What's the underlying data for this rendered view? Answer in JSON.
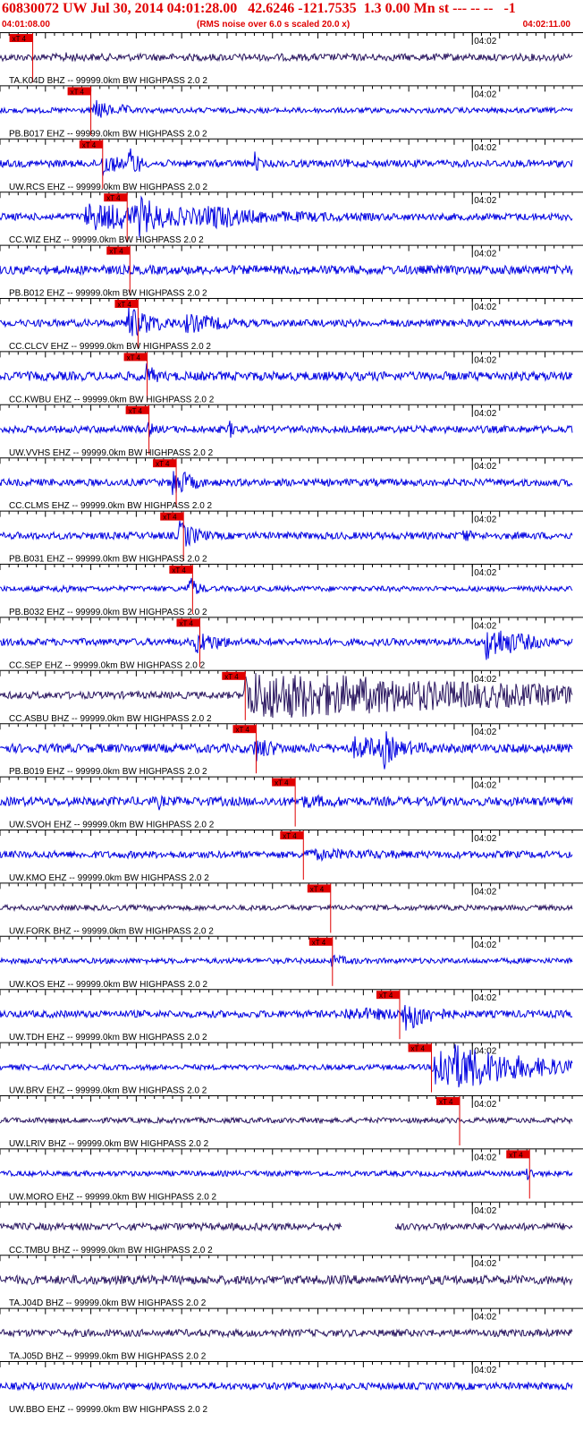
{
  "header": {
    "title": "60830072 UW Jul 30, 2014 04:01:28.00   42.6246 -121.7535  1.3 0.00 Mn st --- -- --   -1",
    "start_time": "04:01:08.00",
    "rms_note": "(RMS noise over 6.0 s scaled 20.0 x)",
    "end_time": "04:02:11.00"
  },
  "colors": {
    "trace": "#0000e0",
    "trace_dark": "#2a1660",
    "pick": "#e00000",
    "text": "#000000",
    "title": "#e00000"
  },
  "chart_data": {
    "type": "line",
    "title": "60830072 UW Jul 30, 2014 04:01:28.00   42.6246 -121.7535  1.3 0.00 Mn st --- -- --   -1",
    "x_range": [
      "04:01:08.00",
      "04:02:11.00"
    ],
    "x_tick_label": "04:02",
    "x_tick_time_s": 52,
    "pick_label": "xT 4",
    "traces": [
      {
        "label": "TA.K04D BHZ -- 99999.0km BW  HIGHPASS  2.0  2",
        "pick_s": 3.6,
        "amp": 4,
        "color": "dark",
        "events": [
          {
            "t": 7.0,
            "dur": 5,
            "amp": 6
          }
        ]
      },
      {
        "label": "PB.B017 EHZ -- 99999.0km BW  HIGHPASS  2.0  2",
        "pick_s": 10.0,
        "amp": 3,
        "color": "blue",
        "events": [
          {
            "t": 10.5,
            "dur": 2,
            "amp": 14
          },
          {
            "t": 13.5,
            "dur": 2,
            "amp": 7
          }
        ]
      },
      {
        "label": "UW.RCS EHZ -- 99999.0km BW  HIGHPASS  2.0  2",
        "pick_s": 11.3,
        "amp": 4,
        "color": "blue",
        "events": [
          {
            "t": 11.2,
            "dur": 2,
            "amp": 18
          },
          {
            "t": 14.3,
            "dur": 1.2,
            "amp": 22
          },
          {
            "t": 28.0,
            "dur": 0.6,
            "amp": 15
          },
          {
            "t": 38.0,
            "dur": 2,
            "amp": 6
          }
        ]
      },
      {
        "label": "CC.WIZ EHZ -- 99999.0km BW  HIGHPASS  2.0  2",
        "pick_s": 14.0,
        "amp": 4,
        "color": "blue",
        "events": [
          {
            "t": 9.5,
            "dur": 24,
            "amp": 16
          },
          {
            "t": 15.0,
            "dur": 4,
            "amp": 26
          },
          {
            "t": 23.0,
            "dur": 5,
            "amp": 18
          }
        ]
      },
      {
        "label": "PB.B012 EHZ -- 99999.0km BW  HIGHPASS  2.0  2",
        "pick_s": 14.3,
        "amp": 5,
        "color": "blue",
        "events": []
      },
      {
        "label": "CC.CLCV EHZ -- 99999.0km BW  HIGHPASS  2.0  2",
        "pick_s": 15.2,
        "amp": 4,
        "color": "blue",
        "events": [
          {
            "t": 14.0,
            "dur": 4,
            "amp": 20
          },
          {
            "t": 20.5,
            "dur": 7,
            "amp": 12
          }
        ]
      },
      {
        "label": "CC.KWBU EHZ -- 99999.0km BW  HIGHPASS  2.0  2",
        "pick_s": 16.2,
        "amp": 5,
        "color": "blue",
        "events": [
          {
            "t": 15.8,
            "dur": 1.6,
            "amp": 18
          }
        ]
      },
      {
        "label": "UW.VVHS EHZ -- 99999.0km BW  HIGHPASS  2.0  2",
        "pick_s": 16.4,
        "amp": 4,
        "color": "blue",
        "events": [
          {
            "t": 16.4,
            "dur": 1,
            "amp": 10
          },
          {
            "t": 25.3,
            "dur": 0.8,
            "amp": 12
          }
        ]
      },
      {
        "label": "CC.CLMS EHZ -- 99999.0km BW  HIGHPASS  2.0  2",
        "pick_s": 19.4,
        "amp": 4,
        "color": "blue",
        "events": [
          {
            "t": 19.0,
            "dur": 2.5,
            "amp": 20
          }
        ]
      },
      {
        "label": "PB.B031 EHZ -- 99999.0km BW  HIGHPASS  2.0  2",
        "pick_s": 20.2,
        "amp": 4,
        "color": "blue",
        "events": [
          {
            "t": 19.8,
            "dur": 2.5,
            "amp": 18
          },
          {
            "t": 51.0,
            "dur": 1,
            "amp": 12
          }
        ]
      },
      {
        "label": "PB.B032 EHZ -- 99999.0km BW  HIGHPASS  2.0  2",
        "pick_s": 21.2,
        "amp": 3,
        "color": "blue",
        "events": [
          {
            "t": 6.5,
            "dur": 1.5,
            "amp": 7
          },
          {
            "t": 20.7,
            "dur": 1.4,
            "amp": 16
          }
        ]
      },
      {
        "label": "CC.SEP EHZ -- 99999.0km BW  HIGHPASS  2.0  2",
        "pick_s": 22.0,
        "amp": 4,
        "color": "blue",
        "events": [
          {
            "t": 21.5,
            "dur": 4,
            "amp": 14
          },
          {
            "t": 53.5,
            "dur": 5,
            "amp": 22
          }
        ]
      },
      {
        "label": "CC.ASBU BHZ -- 99999.0km BW  HIGHPASS  2.0  2",
        "pick_s": 27.0,
        "amp": 4,
        "color": "dark",
        "events": [
          {
            "t": 27.0,
            "dur": 36,
            "amp": 30
          }
        ]
      },
      {
        "label": "PB.B019 EHZ -- 99999.0km BW  HIGHPASS  2.0  2",
        "pick_s": 28.2,
        "amp": 5,
        "color": "blue",
        "events": [
          {
            "t": 28.0,
            "dur": 3,
            "amp": 16
          },
          {
            "t": 39.0,
            "dur": 10,
            "amp": 14
          },
          {
            "t": 42.3,
            "dur": 1.5,
            "amp": 24
          }
        ]
      },
      {
        "label": "UW.SVOH EHZ -- 99999.0km BW  HIGHPASS  2.0  2",
        "pick_s": 32.5,
        "amp": 5,
        "color": "blue",
        "events": [
          {
            "t": 17.5,
            "dur": 1,
            "amp": 10
          },
          {
            "t": 33.0,
            "dur": 14,
            "amp": 8
          }
        ]
      },
      {
        "label": "UW.KMO EHZ -- 99999.0km BW  HIGHPASS  2.0  2",
        "pick_s": 33.4,
        "amp": 4,
        "color": "blue",
        "events": [
          {
            "t": 33.5,
            "dur": 25,
            "amp": 7
          }
        ]
      },
      {
        "label": "UW.FORK BHZ -- 99999.0km BW  HIGHPASS  2.0  2",
        "pick_s": 36.4,
        "amp": 3,
        "color": "dark",
        "events": []
      },
      {
        "label": "UW.KOS EHZ -- 99999.0km BW  HIGHPASS  2.0  2",
        "pick_s": 36.6,
        "amp": 3,
        "color": "blue",
        "events": [
          {
            "t": 36.5,
            "dur": 4,
            "amp": 7
          }
        ]
      },
      {
        "label": "UW.TDH EHZ -- 99999.0km BW  HIGHPASS  2.0  2",
        "pick_s": 44.0,
        "amp": 4,
        "color": "blue",
        "events": [
          {
            "t": 38.0,
            "dur": 20,
            "amp": 8
          },
          {
            "t": 44.5,
            "dur": 3.5,
            "amp": 22
          }
        ]
      },
      {
        "label": "UW.BRV EHZ -- 99999.0km BW  HIGHPASS  2.0  2",
        "pick_s": 47.5,
        "amp": 3,
        "color": "blue",
        "events": [
          {
            "t": 47.8,
            "dur": 10,
            "amp": 34
          }
        ]
      },
      {
        "label": "UW.LRIV BHZ -- 99999.0km BW  HIGHPASS  2.0  2",
        "pick_s": 50.6,
        "amp": 3,
        "color": "dark",
        "events": []
      },
      {
        "label": "UW.MORO EHZ -- 99999.0km BW  HIGHPASS  2.0  2",
        "pick_s": 58.3,
        "amp": 3,
        "color": "blue",
        "events": [
          {
            "t": 58.0,
            "dur": 1,
            "amp": 10
          }
        ]
      },
      {
        "label": "CC.TMBU BHZ -- 99999.0km BW  HIGHPASS  2.0  2",
        "pick_s": null,
        "amp": 4,
        "color": "dark",
        "events": [],
        "gap": [
          37.7,
          43.5
        ]
      },
      {
        "label": "TA.J04D BHZ -- 99999.0km BW  HIGHPASS  2.0  2",
        "pick_s": null,
        "amp": 5,
        "color": "dark",
        "events": []
      },
      {
        "label": "TA.J05D BHZ -- 99999.0km BW  HIGHPASS  2.0  2",
        "pick_s": null,
        "amp": 4,
        "color": "dark",
        "events": []
      },
      {
        "label": "UW.BBO EHZ -- 99999.0km BW  HIGHPASS  2.0  2",
        "pick_s": null,
        "amp": 4,
        "color": "blue",
        "events": []
      }
    ]
  }
}
